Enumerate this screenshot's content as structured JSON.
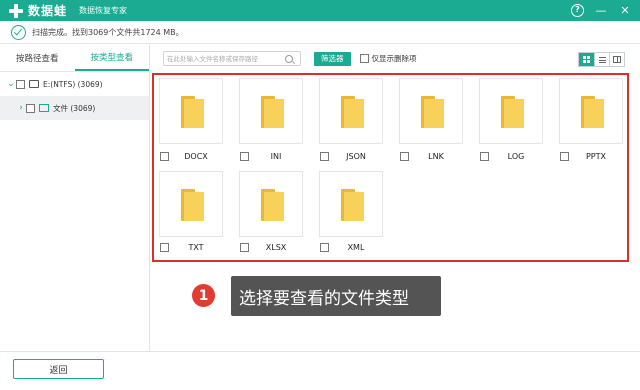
{
  "titlebar": {
    "app_name": "数据蛙",
    "subtitle": "数据恢复专家",
    "accent_color": "#1aab92",
    "help_label": "?",
    "minimize_label": "—",
    "close_label": "✕"
  },
  "status": {
    "text": "扫描完成。找到3069个文件共1724 MB。"
  },
  "sidebar": {
    "tabs": [
      {
        "label": "按路径查看",
        "active": false
      },
      {
        "label": "按类型查看",
        "active": true
      }
    ],
    "tree": [
      {
        "label": "E:(NTFS) (3069)",
        "icon": "drive-icon"
      },
      {
        "label": "文件 (3069)",
        "icon": "file-folder-icon",
        "expand_arrow": "›"
      }
    ]
  },
  "toolbar": {
    "search_placeholder": "在此处输入文件名称或保存路径",
    "filter_label": "筛选器",
    "only_deleted_label": "仅显示删除项",
    "view_modes": [
      "grid-view-icon",
      "list-view-icon",
      "detail-view-icon"
    ],
    "active_view": "grid-view-icon"
  },
  "file_types": [
    {
      "label": "DOCX"
    },
    {
      "label": "INI"
    },
    {
      "label": "JSON"
    },
    {
      "label": "LNK"
    },
    {
      "label": "LOG"
    },
    {
      "label": "PPTX"
    },
    {
      "label": "TXT"
    },
    {
      "label": "XLSX"
    },
    {
      "label": "XML"
    }
  ],
  "annotation": {
    "step_number": "1",
    "text": "选择要查看的文件类型",
    "highlight_color": "#d9302a"
  },
  "footer": {
    "back_label": "返回"
  }
}
